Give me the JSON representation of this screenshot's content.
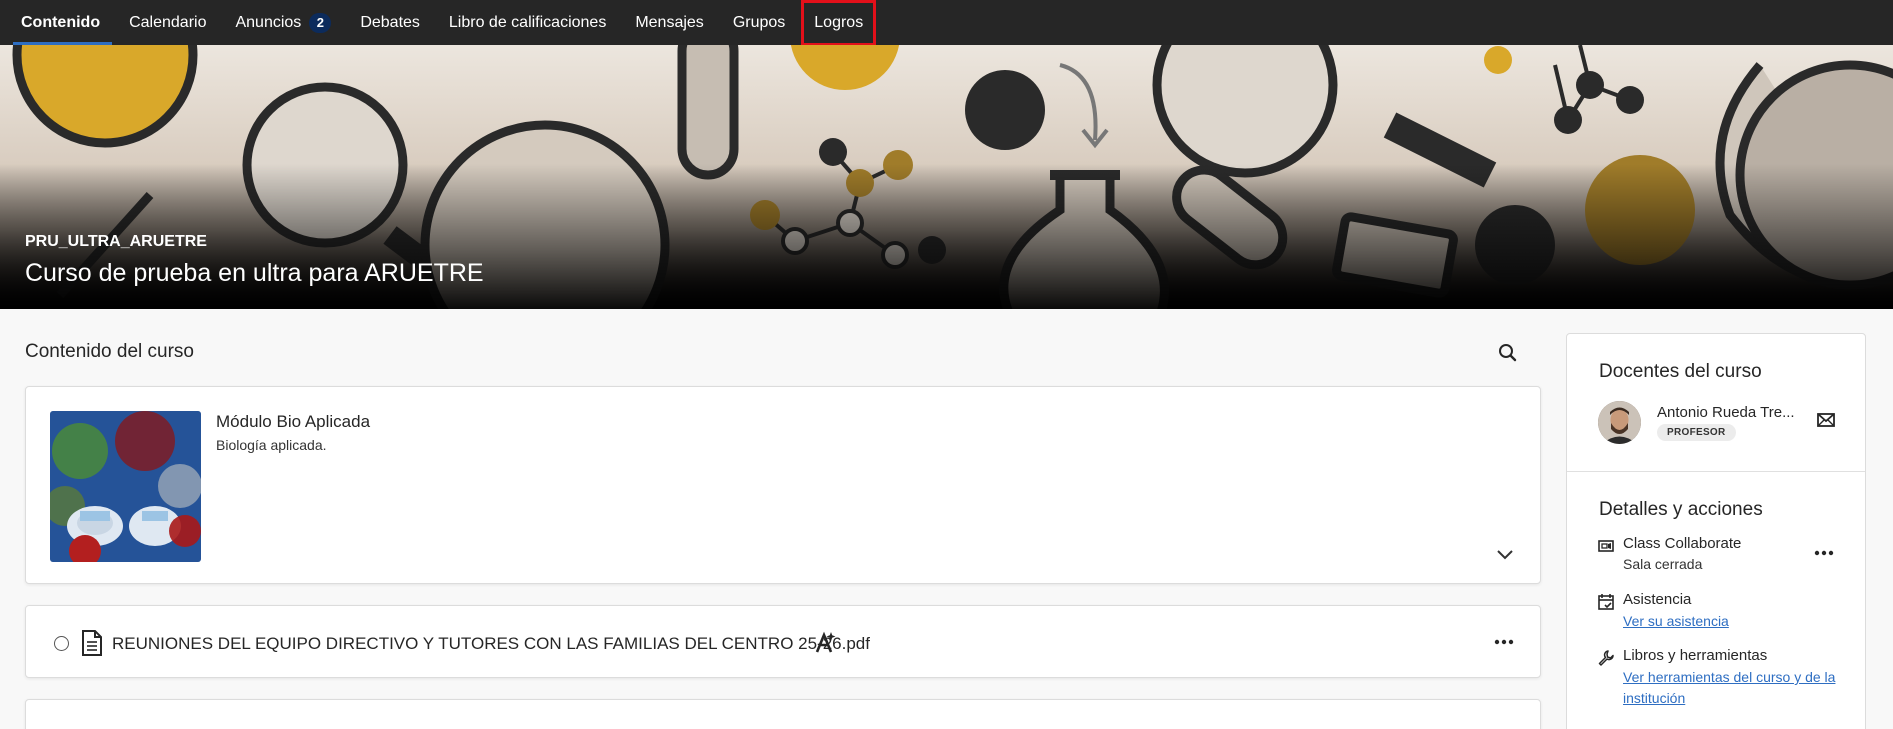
{
  "nav": {
    "tabs": [
      {
        "label": "Contenido",
        "active": true
      },
      {
        "label": "Calendario"
      },
      {
        "label": "Anuncios",
        "badge": "2"
      },
      {
        "label": "Debates"
      },
      {
        "label": "Libro de calificaciones"
      },
      {
        "label": "Mensajes"
      },
      {
        "label": "Grupos"
      },
      {
        "label": "Logros",
        "highlighted": true
      }
    ]
  },
  "course": {
    "id": "PRU_ULTRA_ARUETRE",
    "title": "Curso de prueba en ultra para ARUETRE"
  },
  "content": {
    "heading": "Contenido del curso",
    "module": {
      "title": "Módulo Bio Aplicada",
      "description": "Biología aplicada."
    },
    "file": {
      "name": "REUNIONES DEL EQUIPO DIRECTIVO Y TUTORES CON LAS FAMILIAS DEL CENTRO 25-26.pdf"
    }
  },
  "sidebar": {
    "teachers_heading": "Docentes del curso",
    "teacher": {
      "name": "Antonio Rueda Tre...",
      "role": "PROFESOR"
    },
    "details_heading": "Detalles y acciones",
    "details": [
      {
        "title": "Class Collaborate",
        "sub": "Sala cerrada",
        "icon": "video-icon"
      },
      {
        "title": "Asistencia",
        "link": "Ver su asistencia",
        "icon": "attendance-icon"
      },
      {
        "title": "Libros y herramientas",
        "link": "Ver herramientas del curso y de la institución",
        "icon": "wrench-icon"
      }
    ]
  },
  "colors": {
    "nav_bg": "#262626",
    "accent": "#2e6ec2",
    "highlight_box": "#e3101a",
    "badge_bg": "#0c2b5c"
  }
}
